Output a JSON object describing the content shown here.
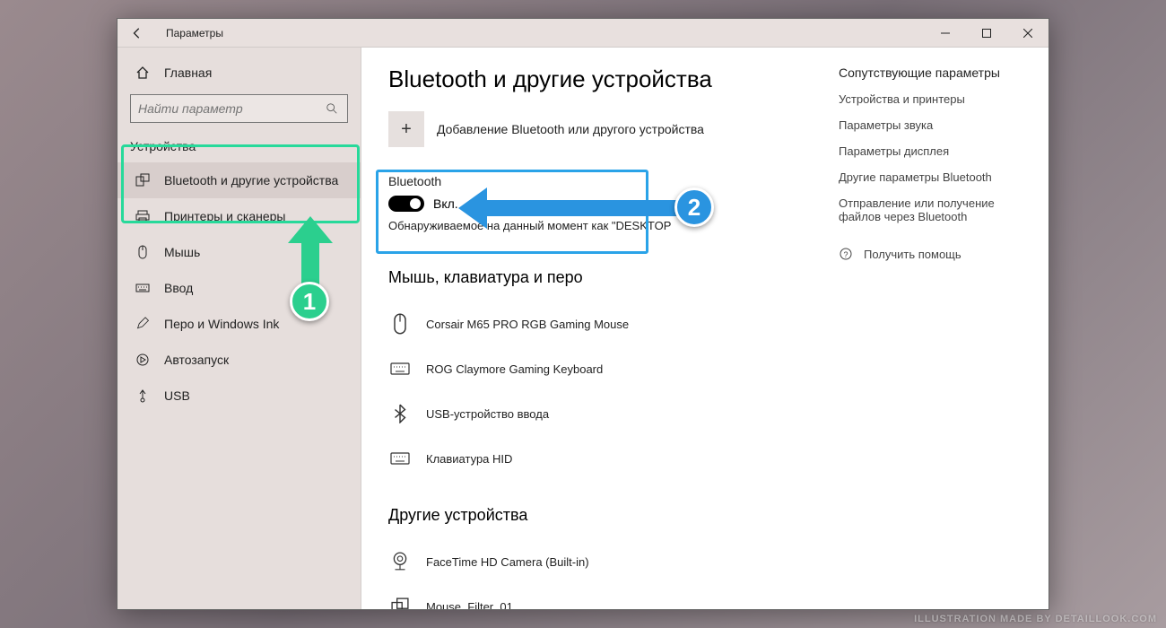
{
  "window": {
    "title": "Параметры"
  },
  "sidebar": {
    "home": "Главная",
    "search_placeholder": "Найти параметр",
    "category": "Устройства",
    "items": [
      {
        "label": "Bluetooth и другие устройства"
      },
      {
        "label": "Принтеры и сканеры"
      },
      {
        "label": "Мышь"
      },
      {
        "label": "Ввод"
      },
      {
        "label": "Перо и Windows Ink"
      },
      {
        "label": "Автозапуск"
      },
      {
        "label": "USB"
      }
    ]
  },
  "main": {
    "heading": "Bluetooth и другие устройства",
    "add_label": "Добавление Bluetooth или другого устройства",
    "bt_heading": "Bluetooth",
    "toggle_state": "Вкл.",
    "discoverable": "Обнаруживаемое на данный момент как \"DESKTOP",
    "section_mouse": "Мышь, клавиатура и перо",
    "devices_mouse": [
      {
        "label": "Corsair M65 PRO RGB Gaming Mouse"
      },
      {
        "label": "ROG Claymore Gaming Keyboard"
      },
      {
        "label": "USB-устройство ввода"
      },
      {
        "label": "Клавиатура HID"
      }
    ],
    "section_other": "Другие устройства",
    "devices_other": [
      {
        "label": "FaceTime HD Camera (Built-in)"
      },
      {
        "label": "Mouse_Filter_01"
      }
    ]
  },
  "related": {
    "heading": "Сопутствующие параметры",
    "links": [
      "Устройства и принтеры",
      "Параметры звука",
      "Параметры дисплея",
      "Другие параметры Bluetooth",
      "Отправление или получение файлов через Bluetooth"
    ],
    "help": "Получить помощь"
  },
  "annotations": {
    "badge1": "1",
    "badge2": "2"
  },
  "watermark": "ILLUSTRATION MADE BY DETAILLOOK.COM"
}
